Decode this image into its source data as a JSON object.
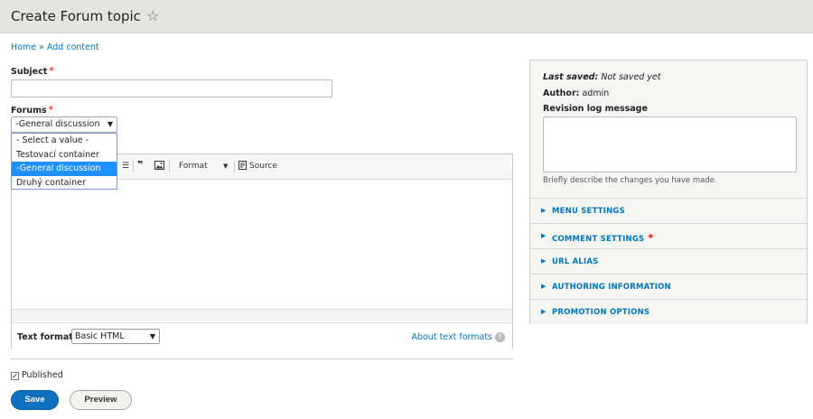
{
  "header": {
    "title": "Create Forum topic"
  },
  "breadcrumb": {
    "home": "Home",
    "separator": "»",
    "current": "Add content"
  },
  "form": {
    "subject_label": "Subject",
    "subject_value": "",
    "required_mark": "*",
    "forums_label": "Forums",
    "forums_selected": "-General discussion",
    "forums_options": [
      "- Select a value -",
      "Testovací container",
      "-General discussion",
      "Druhý container"
    ],
    "toolbar": {
      "quote": "❞",
      "format": "Format",
      "source": "Source"
    },
    "text_format_label": "Text format",
    "text_format_value": "Basic HTML",
    "about_text_formats": "About text formats",
    "published_label": "Published",
    "save_label": "Save",
    "preview_label": "Preview"
  },
  "sidebar": {
    "last_saved_key": "Last saved:",
    "last_saved_value": "Not saved yet",
    "author_key": "Author:",
    "author_value": "admin",
    "revision_label": "Revision log message",
    "revision_desc": "Briefly describe the changes you have made.",
    "sections": [
      "MENU SETTINGS",
      "COMMENT SETTINGS",
      "URL ALIAS",
      "AUTHORING INFORMATION",
      "PROMOTION OPTIONS"
    ]
  },
  "colors": {
    "link": "#0074bd",
    "primary_button": "#0f70c0",
    "required": "#ee0000",
    "selected_option": "#1e90ff"
  }
}
